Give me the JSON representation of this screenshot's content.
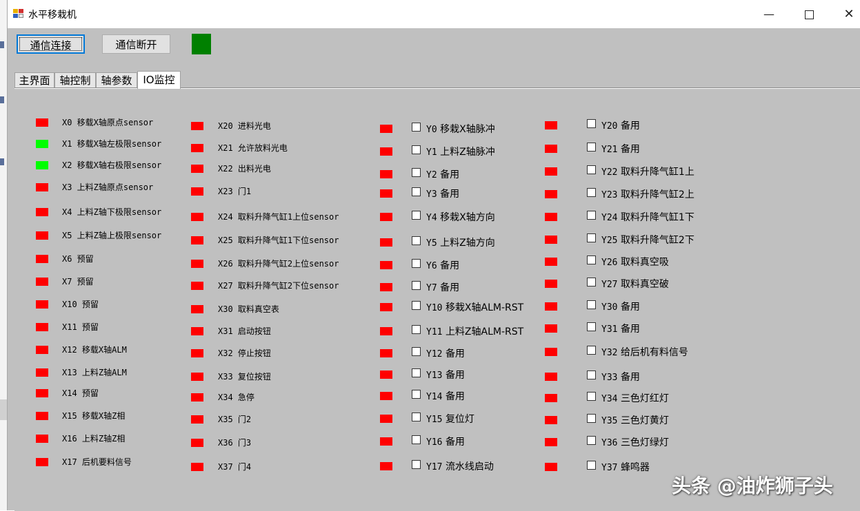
{
  "window": {
    "title": "水平移栽机",
    "controls": {
      "minimize": "—",
      "maximize": "□",
      "close": "✕"
    }
  },
  "toolbar": {
    "connect_label": "通信连接",
    "disconnect_label": "通信断开",
    "status_color": "#008000"
  },
  "tabs": [
    {
      "label": "主界面"
    },
    {
      "label": "轴控制"
    },
    {
      "label": "轴参数"
    },
    {
      "label": "IO监控",
      "active": true
    }
  ],
  "inputs": [
    {
      "label": "X0 移载X轴原点sensor",
      "on": false
    },
    {
      "label": "X1 移载X轴左极限sensor",
      "on": true
    },
    {
      "label": "X2 移载X轴右极限sensor",
      "on": true
    },
    {
      "label": "X3 上料Z轴原点sensor",
      "on": false
    },
    {
      "label": "X4 上料Z轴下极限sensor",
      "on": false
    },
    {
      "label": "X5 上料Z轴上极限sensor",
      "on": false
    },
    {
      "label": "X6 预留",
      "on": false
    },
    {
      "label": "X7 预留",
      "on": false
    },
    {
      "label": "X10 预留",
      "on": false
    },
    {
      "label": "X11 预留",
      "on": false
    },
    {
      "label": "X12 移载X轴ALM",
      "on": false
    },
    {
      "label": "X13 上料Z轴ALM",
      "on": false
    },
    {
      "label": "X14 预留",
      "on": false
    },
    {
      "label": "X15 移载X轴Z相",
      "on": false
    },
    {
      "label": "X16 上料Z轴Z相",
      "on": false
    },
    {
      "label": "X17 后机要料信号",
      "on": false
    },
    {
      "label": "X20 进料光电",
      "on": false
    },
    {
      "label": "X21 允许放料光电",
      "on": false
    },
    {
      "label": "X22 出料光电",
      "on": false
    },
    {
      "label": "X23 门1",
      "on": false
    },
    {
      "label": "X24 取料升降气缸1上位sensor",
      "on": false
    },
    {
      "label": "X25 取料升降气缸1下位sensor",
      "on": false
    },
    {
      "label": "X26 取料升降气缸2上位sensor",
      "on": false
    },
    {
      "label": "X27 取料升降气缸2下位sensor",
      "on": false
    },
    {
      "label": "X30 取料真空表",
      "on": false
    },
    {
      "label": "X31 启动按钮",
      "on": false
    },
    {
      "label": "X32 停止按钮",
      "on": false
    },
    {
      "label": "X33 复位按钮",
      "on": false
    },
    {
      "label": "X34 急停",
      "on": false
    },
    {
      "label": "X35 门2",
      "on": false
    },
    {
      "label": "X36 门3",
      "on": false
    },
    {
      "label": "X37 门4",
      "on": false
    }
  ],
  "outputs": [
    {
      "code": "Y0",
      "name": "移栽X轴脉冲",
      "on": false,
      "checked": false
    },
    {
      "code": "Y1",
      "name": "上料Z轴脉冲",
      "on": false,
      "checked": false
    },
    {
      "code": "Y2",
      "name": "备用",
      "on": false,
      "checked": false
    },
    {
      "code": "Y3",
      "name": "备用",
      "on": false,
      "checked": false
    },
    {
      "code": "Y4",
      "name": "移栽X轴方向",
      "on": false,
      "checked": false
    },
    {
      "code": "Y5",
      "name": "上料Z轴方向",
      "on": false,
      "checked": false
    },
    {
      "code": "Y6",
      "name": "备用",
      "on": false,
      "checked": false
    },
    {
      "code": "Y7",
      "name": "备用",
      "on": false,
      "checked": false
    },
    {
      "code": "Y10",
      "name": "移栽X轴ALM-RST",
      "on": false,
      "checked": false
    },
    {
      "code": "Y11",
      "name": "上料Z轴ALM-RST",
      "on": false,
      "checked": false
    },
    {
      "code": "Y12",
      "name": "备用",
      "on": false,
      "checked": false
    },
    {
      "code": "Y13",
      "name": "备用",
      "on": false,
      "checked": false
    },
    {
      "code": "Y14",
      "name": "备用",
      "on": false,
      "checked": false
    },
    {
      "code": "Y15",
      "name": "复位灯",
      "on": false,
      "checked": false
    },
    {
      "code": "Y16",
      "name": "备用",
      "on": false,
      "checked": false
    },
    {
      "code": "Y17",
      "name": "流水线启动",
      "on": false,
      "checked": false
    },
    {
      "code": "Y20",
      "name": "备用",
      "on": false,
      "checked": false
    },
    {
      "code": "Y21",
      "name": "备用",
      "on": false,
      "checked": false
    },
    {
      "code": "Y22",
      "name": "取料升降气缸1上",
      "on": false,
      "checked": false
    },
    {
      "code": "Y23",
      "name": "取料升降气缸2上",
      "on": false,
      "checked": false
    },
    {
      "code": "Y24",
      "name": "取料升降气缸1下",
      "on": false,
      "checked": false
    },
    {
      "code": "Y25",
      "name": "取料升降气缸2下",
      "on": false,
      "checked": false
    },
    {
      "code": "Y26",
      "name": "取料真空吸",
      "on": false,
      "checked": false
    },
    {
      "code": "Y27",
      "name": "取料真空破",
      "on": false,
      "checked": false
    },
    {
      "code": "Y30",
      "name": "备用",
      "on": false,
      "checked": false
    },
    {
      "code": "Y31",
      "name": "备用",
      "on": false,
      "checked": false
    },
    {
      "code": "Y32",
      "name": "给后机有料信号",
      "on": false,
      "checked": false
    },
    {
      "code": "Y33",
      "name": "备用",
      "on": false,
      "checked": false
    },
    {
      "code": "Y34",
      "name": "三色灯红灯",
      "on": false,
      "checked": false
    },
    {
      "code": "Y35",
      "name": "三色灯黄灯",
      "on": false,
      "checked": false
    },
    {
      "code": "Y36",
      "name": "三色灯绿灯",
      "on": false,
      "checked": false
    },
    {
      "code": "Y37",
      "name": "蜂鸣器",
      "on": false,
      "checked": false
    }
  ],
  "colors": {
    "led_on": "#00ff00",
    "led_off": "#ff0000"
  },
  "watermark": "头条 @油炸狮子头"
}
